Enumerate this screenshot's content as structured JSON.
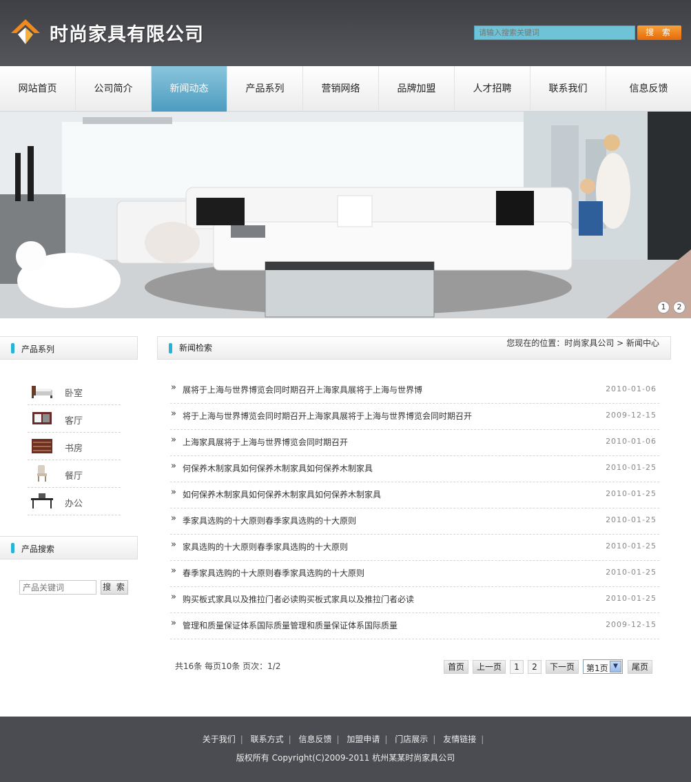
{
  "header": {
    "logo_text": "时尚家具有限公司",
    "search_placeholder": "请输入搜索关键词",
    "search_button": "搜 索"
  },
  "nav": {
    "items": [
      "网站首页",
      "公司简介",
      "新闻动态",
      "产品系列",
      "营销网络",
      "品牌加盟",
      "人才招聘",
      "联系我们",
      "信息反馈"
    ],
    "active_index": 2
  },
  "banner": {
    "dots": [
      "1",
      "2"
    ]
  },
  "sidebar": {
    "product_series_title": "产品系列",
    "categories": [
      {
        "label": "卧室",
        "icon": "bed-icon"
      },
      {
        "label": "客厅",
        "icon": "cabinet-icon"
      },
      {
        "label": "书房",
        "icon": "bookshelf-icon"
      },
      {
        "label": "餐厅",
        "icon": "chair-icon"
      },
      {
        "label": "办公",
        "icon": "desk-icon"
      }
    ],
    "product_search_title": "产品搜索",
    "product_search_placeholder": "产品关键词",
    "product_search_button": "搜 索"
  },
  "main": {
    "title": "新闻检索",
    "breadcrumb": "您现在的位置：时尚家具公司  > 新闻中心",
    "news": [
      {
        "title": "展将于上海与世界博览会同时期召开上海家具展将于上海与世界博",
        "date": "2010-01-06"
      },
      {
        "title": "将于上海与世界博览会同时期召开上海家具展将于上海与世界博览会同时期召开",
        "date": "2009-12-15"
      },
      {
        "title": "上海家具展将于上海与世界博览会同时期召开",
        "date": "2010-01-06"
      },
      {
        "title": "何保养木制家具如何保养木制家具如何保养木制家具",
        "date": "2010-01-25"
      },
      {
        "title": "如何保养木制家具如何保养木制家具如何保养木制家具",
        "date": "2010-01-25"
      },
      {
        "title": "季家具选购的十大原则春季家具选购的十大原则",
        "date": "2010-01-25"
      },
      {
        "title": "家具选购的十大原则春季家具选购的十大原则",
        "date": "2010-01-25"
      },
      {
        "title": "春季家具选购的十大原则春季家具选购的十大原则",
        "date": "2010-01-25"
      },
      {
        "title": "购买板式家具以及推拉门者必读购买板式家具以及推拉门者必读",
        "date": "2010-01-25"
      },
      {
        "title": "管理和质量保证体系国际质量管理和质量保证体系国际质量",
        "date": "2009-12-15"
      }
    ],
    "pager": {
      "info": "共16条  每页10条  页次：1/2",
      "first": "首页",
      "prev": "上一页",
      "pages": [
        "1",
        "2"
      ],
      "next": "下一页",
      "select_value": "第1页",
      "last": "尾页"
    }
  },
  "footer": {
    "links": [
      "关于我们",
      "联系方式",
      "信息反馈",
      "加盟申请",
      "门店展示",
      "友情链接"
    ],
    "copyright": "版权所有  Copyright(C)2009-2011 杭州某某时尚家具公司"
  },
  "colors": {
    "header_bg": "#47484d",
    "accent_blue": "#5aa9c9",
    "search_orange": "#f08a1c",
    "footer_bg": "#4b4c51"
  }
}
